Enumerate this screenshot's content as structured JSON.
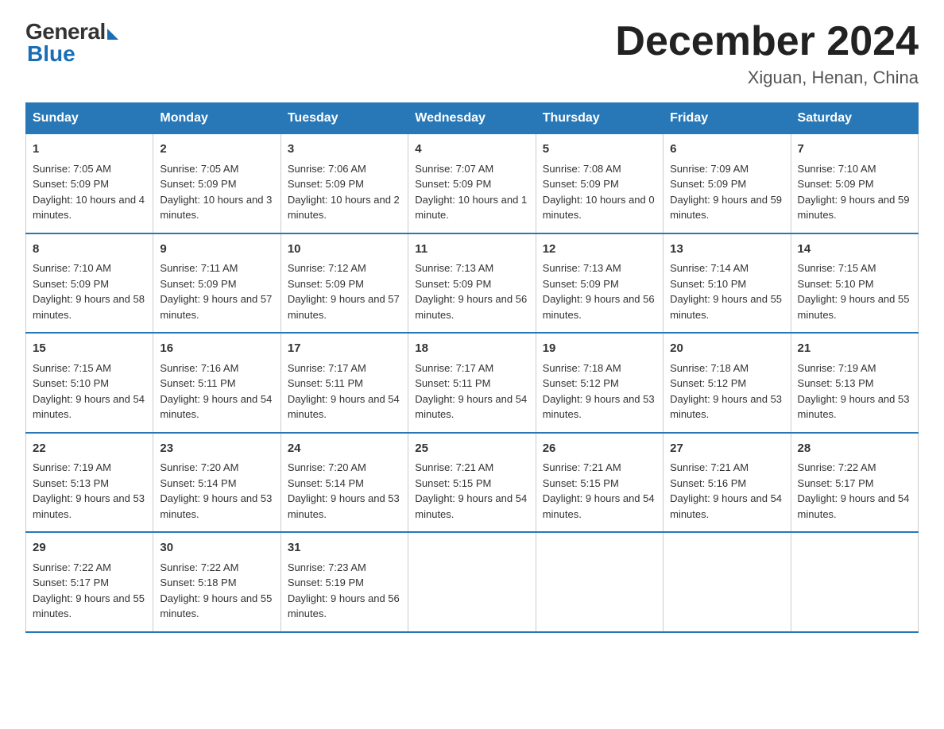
{
  "logo": {
    "general": "General",
    "blue": "Blue"
  },
  "title": "December 2024",
  "location": "Xiguan, Henan, China",
  "weekdays": [
    "Sunday",
    "Monday",
    "Tuesday",
    "Wednesday",
    "Thursday",
    "Friday",
    "Saturday"
  ],
  "weeks": [
    [
      {
        "day": "1",
        "sunrise": "7:05 AM",
        "sunset": "5:09 PM",
        "daylight": "10 hours and 4 minutes."
      },
      {
        "day": "2",
        "sunrise": "7:05 AM",
        "sunset": "5:09 PM",
        "daylight": "10 hours and 3 minutes."
      },
      {
        "day": "3",
        "sunrise": "7:06 AM",
        "sunset": "5:09 PM",
        "daylight": "10 hours and 2 minutes."
      },
      {
        "day": "4",
        "sunrise": "7:07 AM",
        "sunset": "5:09 PM",
        "daylight": "10 hours and 1 minute."
      },
      {
        "day": "5",
        "sunrise": "7:08 AM",
        "sunset": "5:09 PM",
        "daylight": "10 hours and 0 minutes."
      },
      {
        "day": "6",
        "sunrise": "7:09 AM",
        "sunset": "5:09 PM",
        "daylight": "9 hours and 59 minutes."
      },
      {
        "day": "7",
        "sunrise": "7:10 AM",
        "sunset": "5:09 PM",
        "daylight": "9 hours and 59 minutes."
      }
    ],
    [
      {
        "day": "8",
        "sunrise": "7:10 AM",
        "sunset": "5:09 PM",
        "daylight": "9 hours and 58 minutes."
      },
      {
        "day": "9",
        "sunrise": "7:11 AM",
        "sunset": "5:09 PM",
        "daylight": "9 hours and 57 minutes."
      },
      {
        "day": "10",
        "sunrise": "7:12 AM",
        "sunset": "5:09 PM",
        "daylight": "9 hours and 57 minutes."
      },
      {
        "day": "11",
        "sunrise": "7:13 AM",
        "sunset": "5:09 PM",
        "daylight": "9 hours and 56 minutes."
      },
      {
        "day": "12",
        "sunrise": "7:13 AM",
        "sunset": "5:09 PM",
        "daylight": "9 hours and 56 minutes."
      },
      {
        "day": "13",
        "sunrise": "7:14 AM",
        "sunset": "5:10 PM",
        "daylight": "9 hours and 55 minutes."
      },
      {
        "day": "14",
        "sunrise": "7:15 AM",
        "sunset": "5:10 PM",
        "daylight": "9 hours and 55 minutes."
      }
    ],
    [
      {
        "day": "15",
        "sunrise": "7:15 AM",
        "sunset": "5:10 PM",
        "daylight": "9 hours and 54 minutes."
      },
      {
        "day": "16",
        "sunrise": "7:16 AM",
        "sunset": "5:11 PM",
        "daylight": "9 hours and 54 minutes."
      },
      {
        "day": "17",
        "sunrise": "7:17 AM",
        "sunset": "5:11 PM",
        "daylight": "9 hours and 54 minutes."
      },
      {
        "day": "18",
        "sunrise": "7:17 AM",
        "sunset": "5:11 PM",
        "daylight": "9 hours and 54 minutes."
      },
      {
        "day": "19",
        "sunrise": "7:18 AM",
        "sunset": "5:12 PM",
        "daylight": "9 hours and 53 minutes."
      },
      {
        "day": "20",
        "sunrise": "7:18 AM",
        "sunset": "5:12 PM",
        "daylight": "9 hours and 53 minutes."
      },
      {
        "day": "21",
        "sunrise": "7:19 AM",
        "sunset": "5:13 PM",
        "daylight": "9 hours and 53 minutes."
      }
    ],
    [
      {
        "day": "22",
        "sunrise": "7:19 AM",
        "sunset": "5:13 PM",
        "daylight": "9 hours and 53 minutes."
      },
      {
        "day": "23",
        "sunrise": "7:20 AM",
        "sunset": "5:14 PM",
        "daylight": "9 hours and 53 minutes."
      },
      {
        "day": "24",
        "sunrise": "7:20 AM",
        "sunset": "5:14 PM",
        "daylight": "9 hours and 53 minutes."
      },
      {
        "day": "25",
        "sunrise": "7:21 AM",
        "sunset": "5:15 PM",
        "daylight": "9 hours and 54 minutes."
      },
      {
        "day": "26",
        "sunrise": "7:21 AM",
        "sunset": "5:15 PM",
        "daylight": "9 hours and 54 minutes."
      },
      {
        "day": "27",
        "sunrise": "7:21 AM",
        "sunset": "5:16 PM",
        "daylight": "9 hours and 54 minutes."
      },
      {
        "day": "28",
        "sunrise": "7:22 AM",
        "sunset": "5:17 PM",
        "daylight": "9 hours and 54 minutes."
      }
    ],
    [
      {
        "day": "29",
        "sunrise": "7:22 AM",
        "sunset": "5:17 PM",
        "daylight": "9 hours and 55 minutes."
      },
      {
        "day": "30",
        "sunrise": "7:22 AM",
        "sunset": "5:18 PM",
        "daylight": "9 hours and 55 minutes."
      },
      {
        "day": "31",
        "sunrise": "7:23 AM",
        "sunset": "5:19 PM",
        "daylight": "9 hours and 56 minutes."
      },
      null,
      null,
      null,
      null
    ]
  ],
  "labels": {
    "sunrise": "Sunrise:",
    "sunset": "Sunset:",
    "daylight": "Daylight:"
  }
}
